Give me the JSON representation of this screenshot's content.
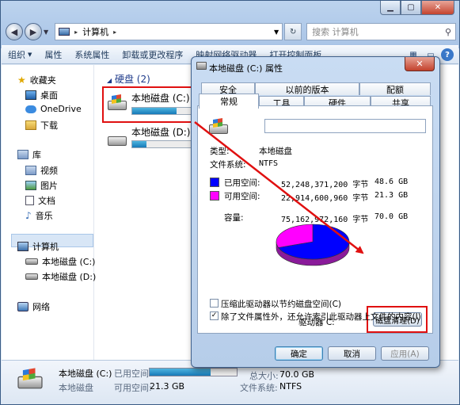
{
  "explorer": {
    "address": {
      "segment": "计算机",
      "arrow": "▸"
    },
    "search_placeholder": "搜索 计算机",
    "toolbar": [
      "组织",
      "属性",
      "系统属性",
      "卸载或更改程序",
      "映射网络驱动器",
      "打开控制面板"
    ],
    "sidebar": {
      "favorites": "收藏夹",
      "desktop": "桌面",
      "onedrive": "OneDrive",
      "downloads": "下载",
      "libraries": "库",
      "videos": "视频",
      "pictures": "图片",
      "documents": "文档",
      "music": "音乐",
      "computer": "计算机",
      "drive_c": "本地磁盘 (C:)",
      "drive_d": "本地磁盘 (D:)",
      "network": "网络"
    },
    "group_header": "硬盘 (2)",
    "drives": [
      {
        "name": "本地磁盘 (C:)",
        "usage": 0.7
      },
      {
        "name": "本地磁盘 (D:)",
        "usage": 0.23
      }
    ],
    "details": {
      "name": "本地磁盘 (C:)",
      "type": "本地磁盘",
      "used_label": "已用空间:",
      "free_label": "可用空间:",
      "free_value": "21.3 GB",
      "total_label": "总大小:",
      "total_value": "70.0 GB",
      "fs_label": "文件系统:",
      "fs_value": "NTFS",
      "usage": 0.7
    }
  },
  "dialog": {
    "title": "本地磁盘 (C:) 属性",
    "close": "✕",
    "tabs_back": [
      "安全",
      "以前的版本",
      "配额"
    ],
    "tabs_front": [
      "常规",
      "工具",
      "硬件",
      "共享"
    ],
    "name_value": "",
    "type_label": "类型:",
    "type_value": "本地磁盘",
    "fs_label": "文件系统:",
    "fs_value": "NTFS",
    "used_label": "已用空间:",
    "used_bytes": "52,248,371,200 字节",
    "used_gb": "48.6 GB",
    "free_label": "可用空间:",
    "free_bytes": "22,914,600,960 字节",
    "free_gb": "21.3 GB",
    "cap_label": "容量:",
    "cap_bytes": "75,162,972,160 字节",
    "cap_gb": "70.0 GB",
    "drive_label": "驱动器 C:",
    "cleanup_button": "磁盘清理(D)",
    "compress_label": "压缩此驱动器以节约磁盘空间(C)",
    "compress_checked": false,
    "index_label": "除了文件属性外，还允许索引此驱动器上文件的内容(I)",
    "index_checked": true,
    "ok": "确定",
    "cancel": "取消",
    "apply": "应用(A)",
    "colors": {
      "used": "#0000ff",
      "free": "#ff00ff"
    },
    "used_fraction": 0.695
  }
}
